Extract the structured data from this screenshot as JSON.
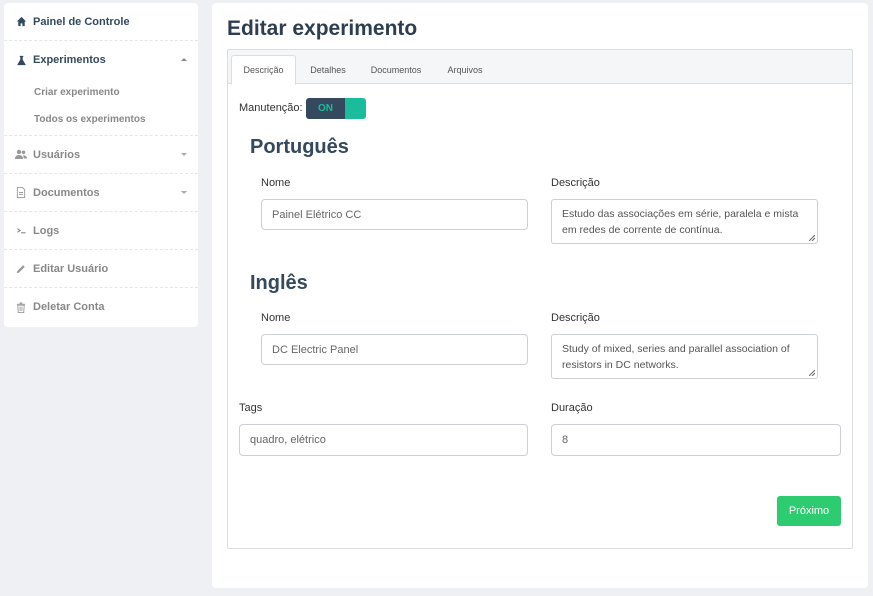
{
  "sidebar": {
    "items": [
      {
        "label": "Painel de Controle",
        "icon": "home-icon"
      },
      {
        "label": "Experimentos",
        "icon": "flask-icon"
      },
      {
        "label": "Usuários",
        "icon": "users-icon"
      },
      {
        "label": "Documentos",
        "icon": "document-icon"
      },
      {
        "label": "Logs",
        "icon": "terminal-icon"
      },
      {
        "label": "Editar Usuário",
        "icon": "pencil-icon"
      },
      {
        "label": "Deletar Conta",
        "icon": "trash-icon"
      }
    ],
    "sub_items": [
      "Criar experimento",
      "Todos os experimentos"
    ]
  },
  "main": {
    "title": "Editar experimento",
    "tabs": [
      "Descrição",
      "Detalhes",
      "Documentos",
      "Arquivos"
    ],
    "maintenance_label": "Manutenção:",
    "maintenance_state": "ON",
    "portuguese": {
      "heading": "Português",
      "name_label": "Nome",
      "name_value": "Painel Elétrico CC",
      "desc_label": "Descrição",
      "desc_value": "Estudo das associações em série, paralela e mista em redes de corrente de contínua."
    },
    "english": {
      "heading": "Inglês",
      "name_label": "Nome",
      "name_value": "DC Electric Panel",
      "desc_label": "Descrição",
      "desc_value": "Study of mixed, series and  parallel association of resistors in DC networks."
    },
    "tags_label": "Tags",
    "tags_value": "quadro, elétrico",
    "duration_label": "Duração",
    "duration_value": "8",
    "next_button": "Próximo"
  },
  "colors": {
    "accent_green": "#2ecc71",
    "toggle_teal": "#1abc9c",
    "dark_navy": "#34495e"
  }
}
